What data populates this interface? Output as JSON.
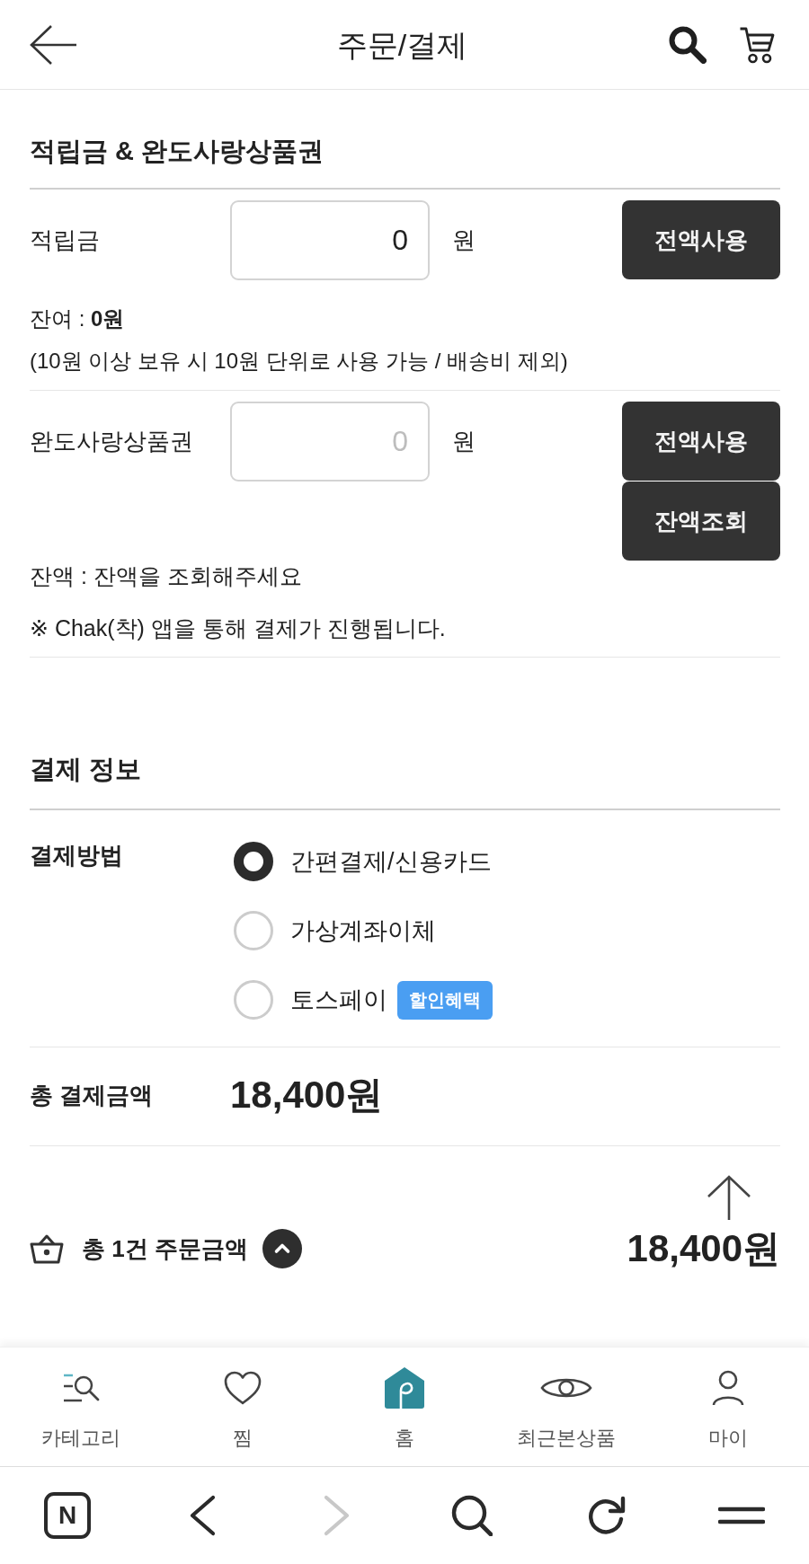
{
  "header": {
    "title": "주문/결제"
  },
  "points_section": {
    "title": "적립금 & 완도사랑상품권",
    "rows": [
      {
        "label": "적립금",
        "value": "0",
        "unit": "원",
        "buttons": [
          "전액사용"
        ],
        "notes": [
          "잔여 : **0원**",
          "(10원 이상 보유 시 10원 단위로 사용 가능 / 배송비 제외)"
        ]
      },
      {
        "label": "완도사랑상품권",
        "placeholder": "0",
        "unit": "원",
        "buttons": [
          "전액사용",
          "잔액조회"
        ],
        "notes": [
          "잔액 : 잔액을 조회해주세요",
          "※ Chak(착) 앱을 통해 결제가 진행됩니다."
        ]
      }
    ]
  },
  "payment_section": {
    "title": "결제 정보",
    "method_label": "결제방법",
    "methods": [
      {
        "label": "간편결제/신용카드",
        "selected": true
      },
      {
        "label": "가상계좌이체",
        "selected": false
      },
      {
        "label": "토스페이",
        "selected": false,
        "badge": "할인혜택"
      }
    ],
    "total_label": "총 결제금액",
    "total_amount": "18,400원"
  },
  "order_summary": {
    "label": "총 1건 주문금액",
    "amount": "18,400원"
  },
  "bottom_nav": {
    "items": [
      {
        "label": "카테고리"
      },
      {
        "label": "찜"
      },
      {
        "label": "홈"
      },
      {
        "label": "최근본상품"
      },
      {
        "label": "마이"
      }
    ]
  },
  "browser_bar": {
    "logo_text": "N",
    "back_disabled": false,
    "forward_disabled": true
  }
}
